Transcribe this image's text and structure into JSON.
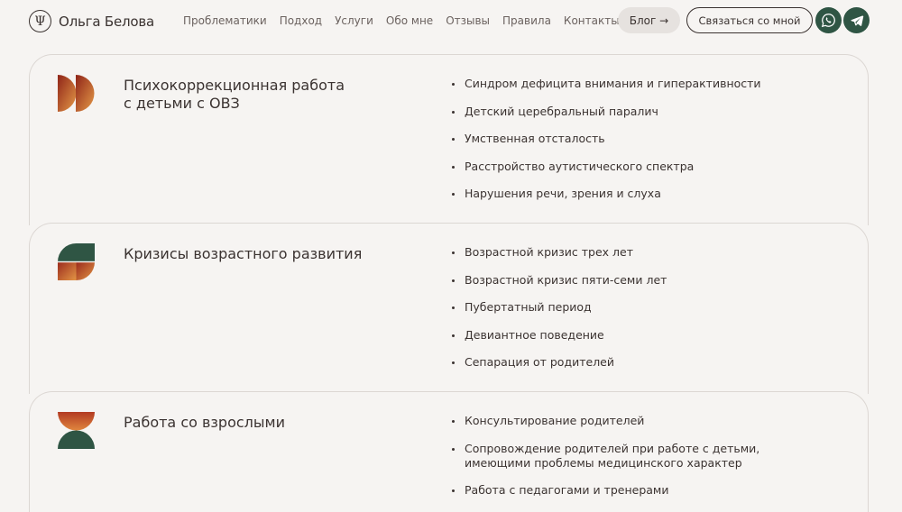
{
  "brand": {
    "logo_glyph": "Ψ",
    "name": "Ольга Белова"
  },
  "nav": [
    {
      "label": "Проблематики"
    },
    {
      "label": "Подход"
    },
    {
      "label": "Услуги"
    },
    {
      "label": "Обо мне"
    },
    {
      "label": "Отзывы"
    },
    {
      "label": "Правила"
    },
    {
      "label": "Контакты"
    }
  ],
  "header": {
    "blog_label": "Блог →",
    "contact_label": "Связаться со мной",
    "social": [
      "whatsapp-icon",
      "telegram-icon"
    ]
  },
  "colors": {
    "background": "#f6f4f2",
    "text": "#3b3331",
    "accent_green": "#2f5544",
    "accent_red": "#9e2b22",
    "accent_orange": "#d9803a"
  },
  "services": [
    {
      "title_line1": "Психокоррекционная работа",
      "title_line2": "с детьми с ОВЗ",
      "items": [
        "Синдром дефицита внимания и гиперактивности",
        "Детский церебральный паралич",
        "Умственная отсталость",
        "Расстройство аутистического спектра",
        "Нарушения речи, зрения и слуха"
      ]
    },
    {
      "title_line1": "Кризисы возрастного развития",
      "title_line2": "",
      "items": [
        "Возрастной кризис трех лет",
        "Возрастной кризис пяти-семи лет",
        "Пубертатный период",
        "Девиантное поведение",
        "Сепарация от родителей"
      ]
    },
    {
      "title_line1": "Работа со взрослыми",
      "title_line2": "",
      "items": [
        "Консультирование родителей",
        "Сопровождение родителей при работе с детьми, имеющими проблемы медицинского характер",
        "Работа с педагогами и тренерами"
      ]
    }
  ]
}
